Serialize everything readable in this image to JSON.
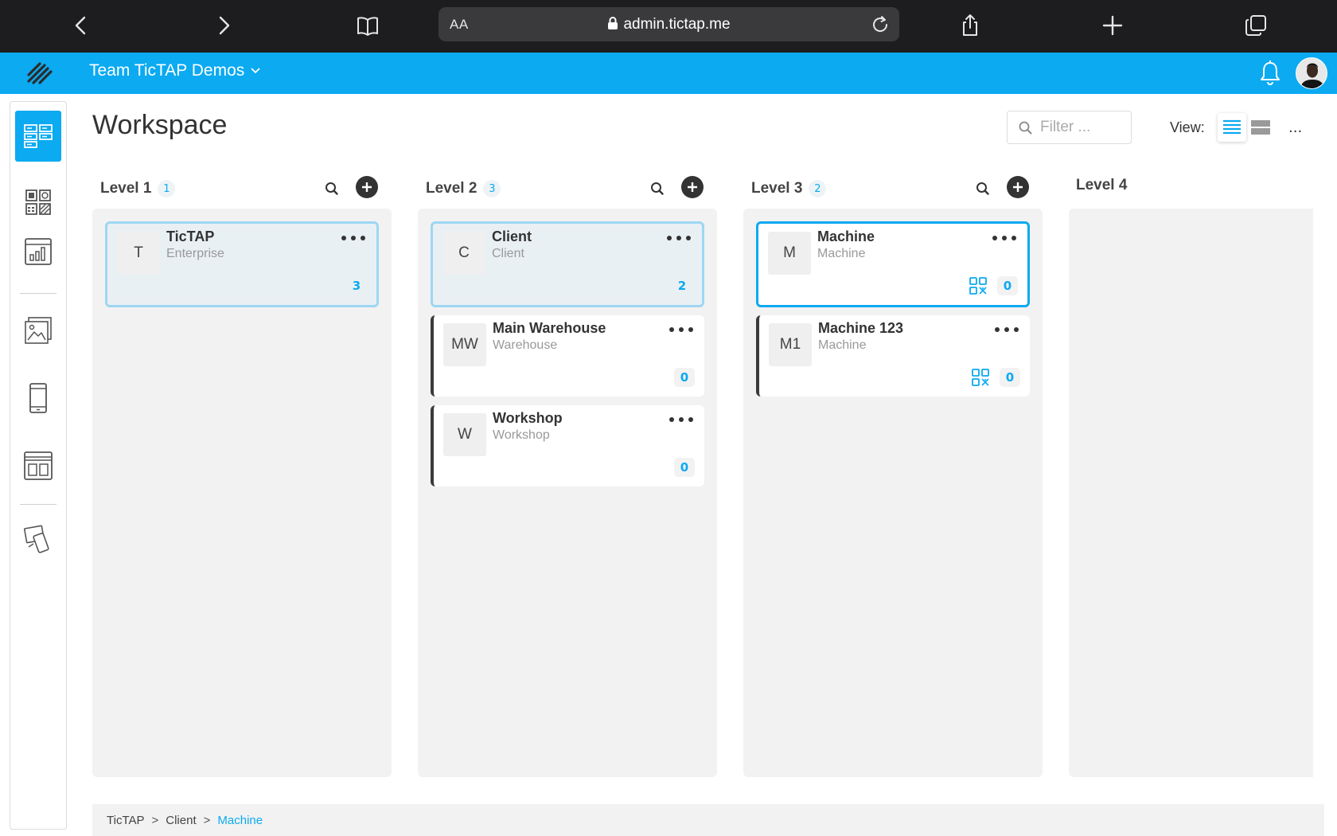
{
  "browser": {
    "text_size_label": "AA",
    "url": "admin.tictap.me"
  },
  "header": {
    "team_name": "Team TicTAP Demos",
    "accent_color": "#0baaf1"
  },
  "sidebar": {
    "items": [
      {
        "icon": "workspace-icon",
        "active": true
      },
      {
        "icon": "qr-codes-icon"
      },
      {
        "icon": "analytics-icon"
      },
      {
        "icon": "media-icon"
      },
      {
        "icon": "device-icon"
      },
      {
        "icon": "layouts-icon"
      },
      {
        "icon": "devices-icon"
      }
    ]
  },
  "page": {
    "title": "Workspace",
    "filter_placeholder": "Filter ...",
    "view_label": "View:",
    "more_label": "..."
  },
  "columns": [
    {
      "title": "Level 1",
      "count": "1",
      "cards": [
        {
          "abbr": "T",
          "name": "TicTAP",
          "type": "Enterprise",
          "badge": "3",
          "state": "selected"
        }
      ]
    },
    {
      "title": "Level 2",
      "count": "3",
      "cards": [
        {
          "abbr": "C",
          "name": "Client",
          "type": "Client",
          "badge": "2",
          "state": "selected"
        },
        {
          "abbr": "MW",
          "name": "Main Warehouse",
          "type": "Warehouse",
          "badge": "0",
          "state": "normal"
        },
        {
          "abbr": "W",
          "name": "Workshop",
          "type": "Workshop",
          "badge": "0",
          "state": "normal"
        }
      ]
    },
    {
      "title": "Level 3",
      "count": "2",
      "cards": [
        {
          "abbr": "M",
          "name": "Machine",
          "type": "Machine",
          "badge": "0",
          "state": "active"
        },
        {
          "abbr": "M1",
          "name": "Machine 123",
          "type": "Machine",
          "badge": "0",
          "state": "normal"
        }
      ]
    },
    {
      "title": "Level 4"
    }
  ],
  "breadcrumb": [
    "TicTAP",
    "Client",
    "Machine"
  ],
  "breadcrumb_separator": ">"
}
